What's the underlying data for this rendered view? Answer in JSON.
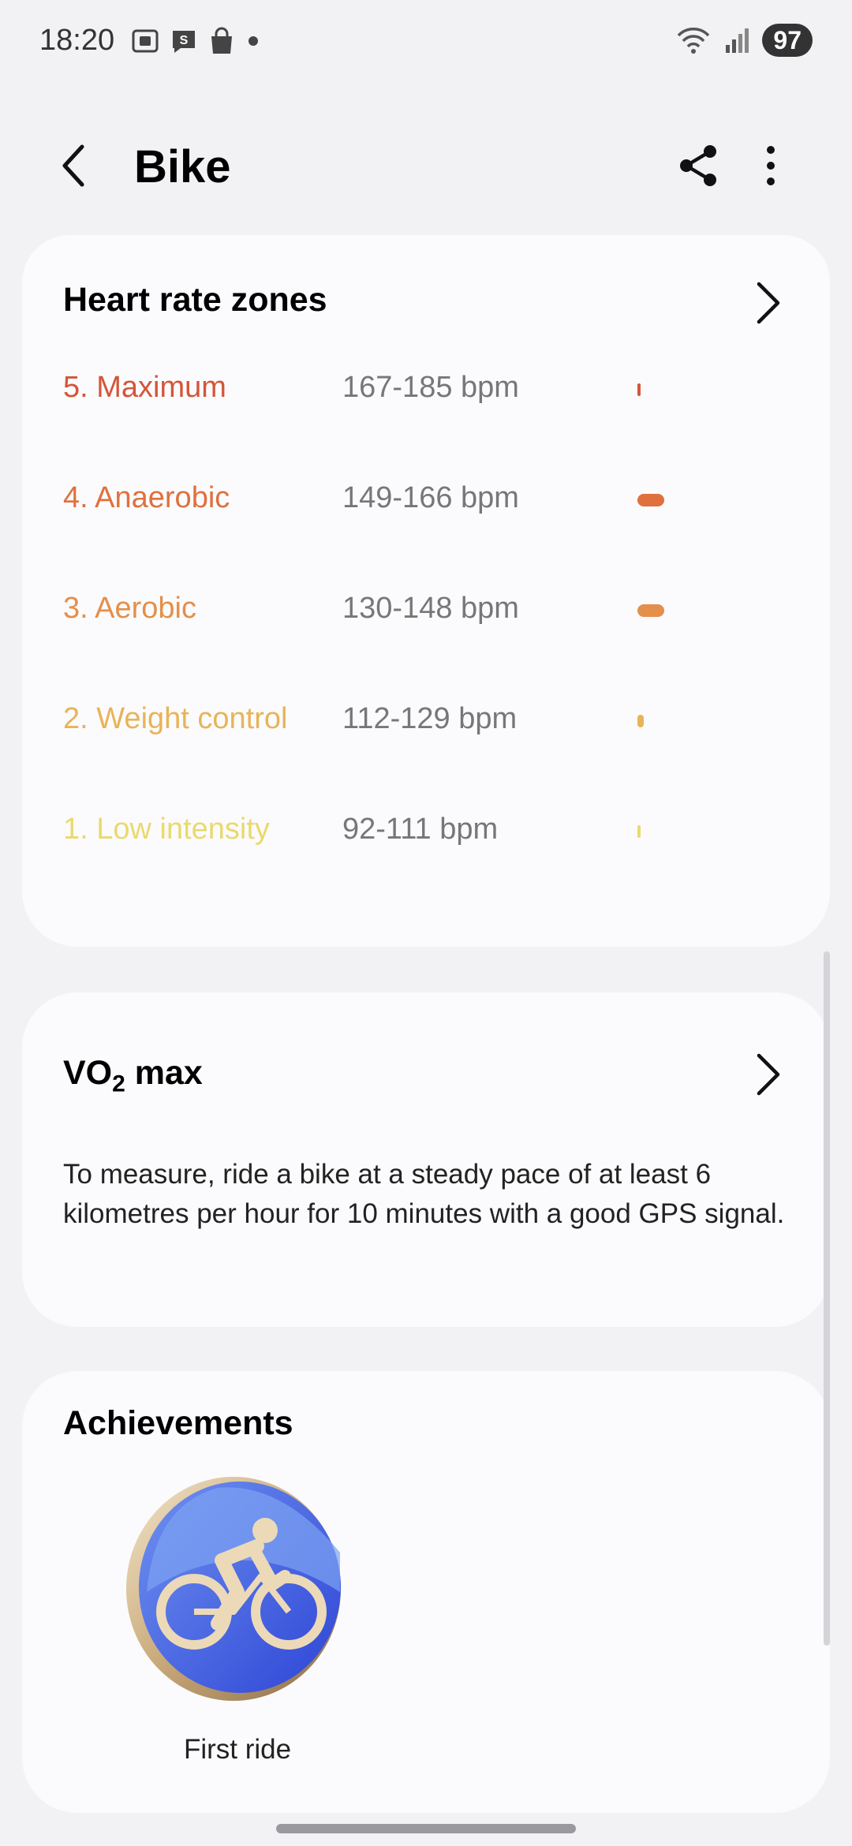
{
  "status_bar": {
    "time": "18:20",
    "battery": "97",
    "icons_left": [
      "screenshot-icon",
      "s-app-icon",
      "shopping-bag-icon",
      "dot-icon"
    ],
    "icons_right": [
      "wifi-icon",
      "signal-icon"
    ]
  },
  "app_bar": {
    "title": "Bike",
    "back_icon": "back-chevron-icon",
    "share_icon": "share-icon",
    "more_icon": "more-vertical-icon"
  },
  "heart_rate": {
    "title": "Heart rate zones",
    "zones": [
      {
        "name": "5. Maximum",
        "range": "167-185 bpm",
        "color": "#d4553a",
        "bar_fraction": 0.05
      },
      {
        "name": "4. Anaerobic",
        "range": "149-166 bpm",
        "color": "#e0703e",
        "bar_fraction": 0.8
      },
      {
        "name": "3. Aerobic",
        "range": "130-148 bpm",
        "color": "#e48f4a",
        "bar_fraction": 0.8
      },
      {
        "name": "2. Weight control",
        "range": "112-129 bpm",
        "color": "#e8b458",
        "bar_fraction": 0.15
      },
      {
        "name": "1. Low intensity",
        "range": "92-111 bpm",
        "color": "#ead96e",
        "bar_fraction": 0.03
      }
    ]
  },
  "vo2": {
    "title_prefix": "VO",
    "title_sub": "2",
    "title_suffix": " max",
    "description": "To measure, ride a bike at a steady pace of at least 6 kilometres per hour for 10 minutes with a good GPS signal."
  },
  "achievements": {
    "title": "Achievements",
    "items": [
      {
        "label": "First ride",
        "icon": "cycling-badge-icon"
      }
    ]
  }
}
